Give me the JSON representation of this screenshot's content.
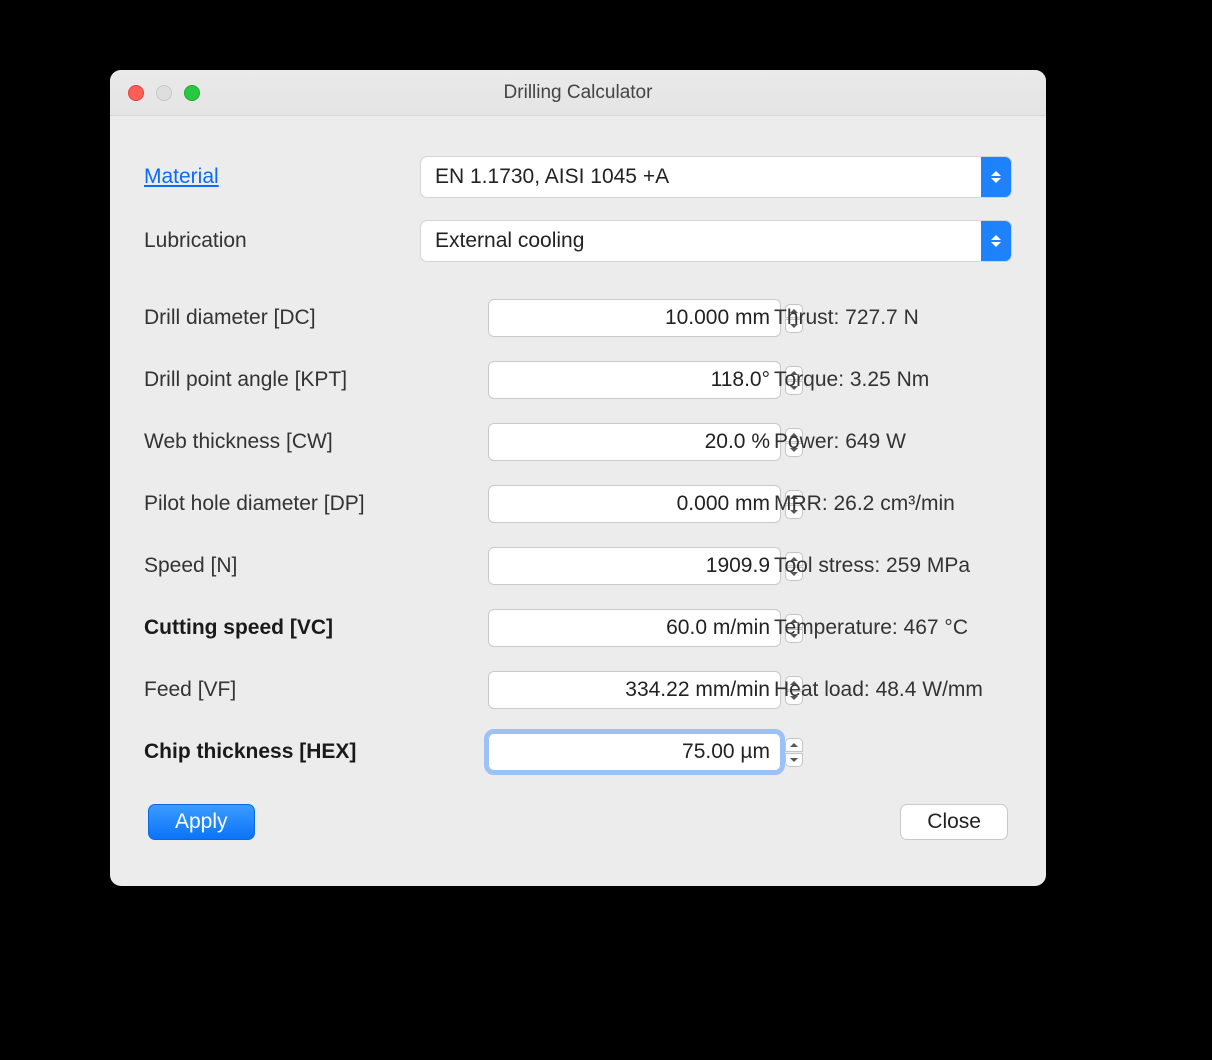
{
  "title": "Drilling Calculator",
  "selectors": {
    "material_label": "Material",
    "material_value": "EN 1.1730, AISI 1045 +A",
    "lubrication_label": "Lubrication",
    "lubrication_value": "External cooling"
  },
  "params": [
    {
      "label": "Drill diameter [DC]",
      "value": "10.000 mm",
      "bold": false,
      "result": "Thrust: 727.7 N"
    },
    {
      "label": "Drill point angle [KPT]",
      "value": "118.0°",
      "bold": false,
      "result": "Torque: 3.25 Nm"
    },
    {
      "label": "Web thickness [CW]",
      "value": "20.0 %",
      "bold": false,
      "result": "Power: 649 W"
    },
    {
      "label": "Pilot hole diameter [DP]",
      "value": "0.000 mm",
      "bold": false,
      "result": "MRR: 26.2 cm³/min"
    },
    {
      "label": "Speed [N]",
      "value": "1909.9",
      "bold": false,
      "result": "Tool stress: 259 MPa"
    },
    {
      "label": "Cutting speed [VC]",
      "value": "60.0 m/min",
      "bold": true,
      "result": "Temperature: 467 °C"
    },
    {
      "label": "Feed [VF]",
      "value": "334.22 mm/min",
      "bold": false,
      "result": "Heat load: 48.4 W/mm"
    },
    {
      "label": "Chip thickness [HEX]",
      "value": "75.00 µm",
      "bold": true,
      "result": "",
      "focused": true
    }
  ],
  "buttons": {
    "apply": "Apply",
    "close": "Close"
  }
}
